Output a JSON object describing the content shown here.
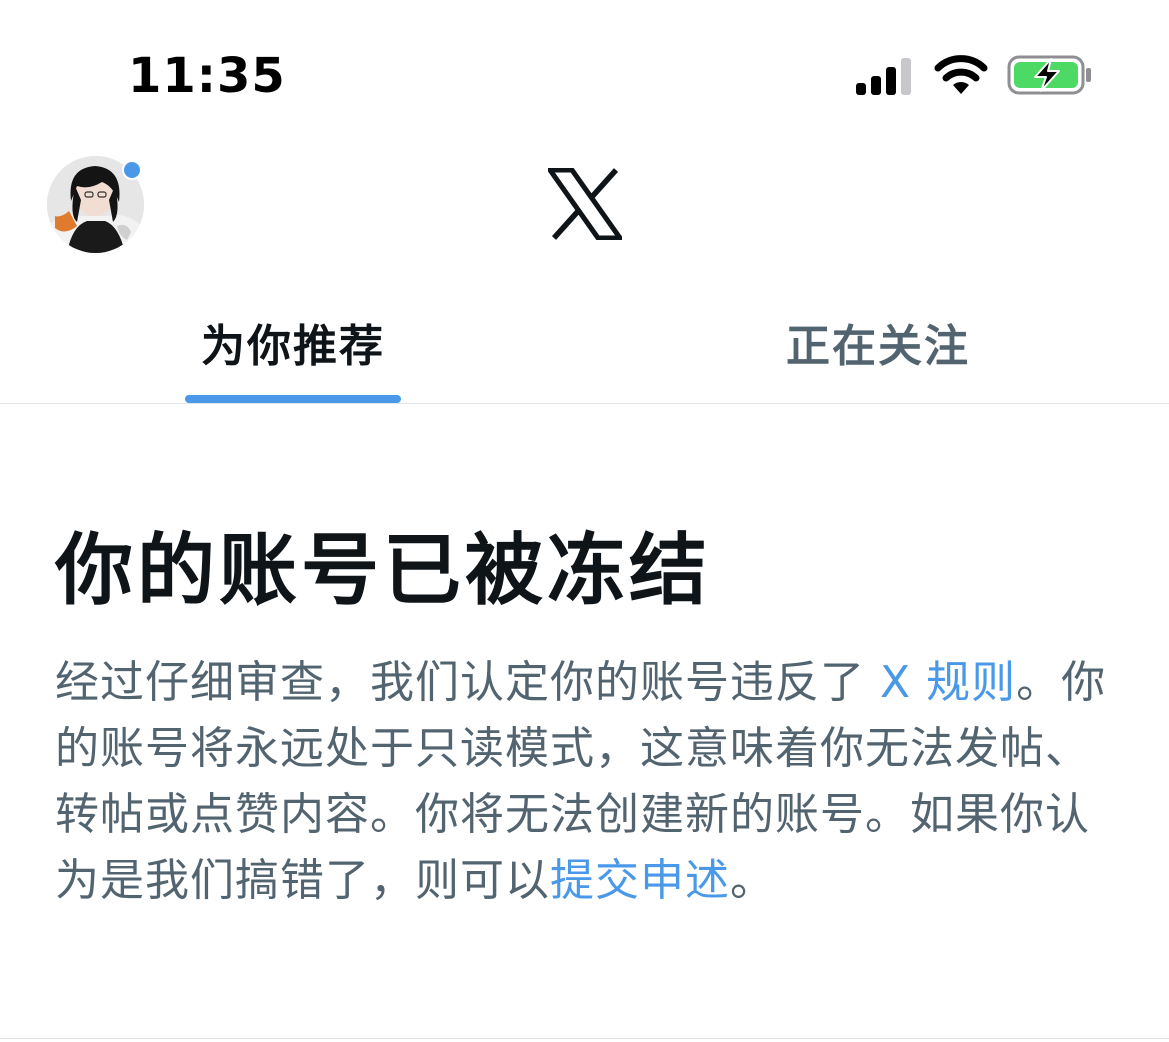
{
  "status_bar": {
    "time": "11:35",
    "icons": [
      "cellular-signal-icon",
      "wifi-icon",
      "battery-charging-icon"
    ],
    "battery_color": "#4cd964"
  },
  "header": {
    "logo": "x-logo-icon",
    "avatar": "user-avatar",
    "notification_dot_color": "#4a99e9"
  },
  "tabs": [
    {
      "label": "为你推荐",
      "active": true
    },
    {
      "label": "正在关注",
      "active": false
    }
  ],
  "notice": {
    "title": "你的账号已被冻结",
    "body_part1": "经过仔细审查，我们认定你的账号违反了 ",
    "rules_link": "X 规则",
    "body_part2": "。你的账号将永远处于只读模式，这意味着你无法发帖、转帖或点赞内容。你将无法创建新的账号。如果你认为是我们搞错了，则可以",
    "appeal_link": "提交申述",
    "body_part3": "。"
  },
  "colors": {
    "accent": "#4a99e9",
    "text_primary": "#0f1419",
    "text_secondary": "#536471",
    "divider": "#e1e4e8"
  }
}
